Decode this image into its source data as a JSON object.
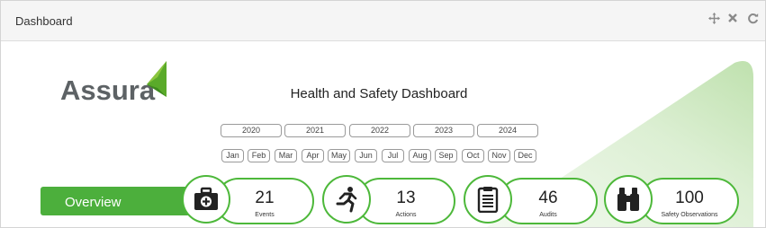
{
  "panel": {
    "title": "Dashboard",
    "icons": [
      "move-icon",
      "close-icon",
      "refresh-icon"
    ]
  },
  "logo": {
    "text": "Assura"
  },
  "dashboard_title": "Health and Safety Dashboard",
  "years": [
    "2020",
    "2021",
    "2022",
    "2023",
    "2024"
  ],
  "months": [
    "Jan",
    "Feb",
    "Mar",
    "Apr",
    "May",
    "Jun",
    "Jul",
    "Aug",
    "Sep",
    "Oct",
    "Nov",
    "Dec"
  ],
  "overview_label": "Overview",
  "stats": [
    {
      "icon": "first-aid-kit-icon",
      "value": "21",
      "label": "Events"
    },
    {
      "icon": "running-person-icon",
      "value": "13",
      "label": "Actions"
    },
    {
      "icon": "clipboard-icon",
      "value": "46",
      "label": "Audits"
    },
    {
      "icon": "binoculars-icon",
      "value": "100",
      "label": "Safety Observations"
    }
  ],
  "colors": {
    "accent_green": "#4caf3c",
    "logo_gray": "#5d6265",
    "background_gradient": "#c9e6bd"
  }
}
